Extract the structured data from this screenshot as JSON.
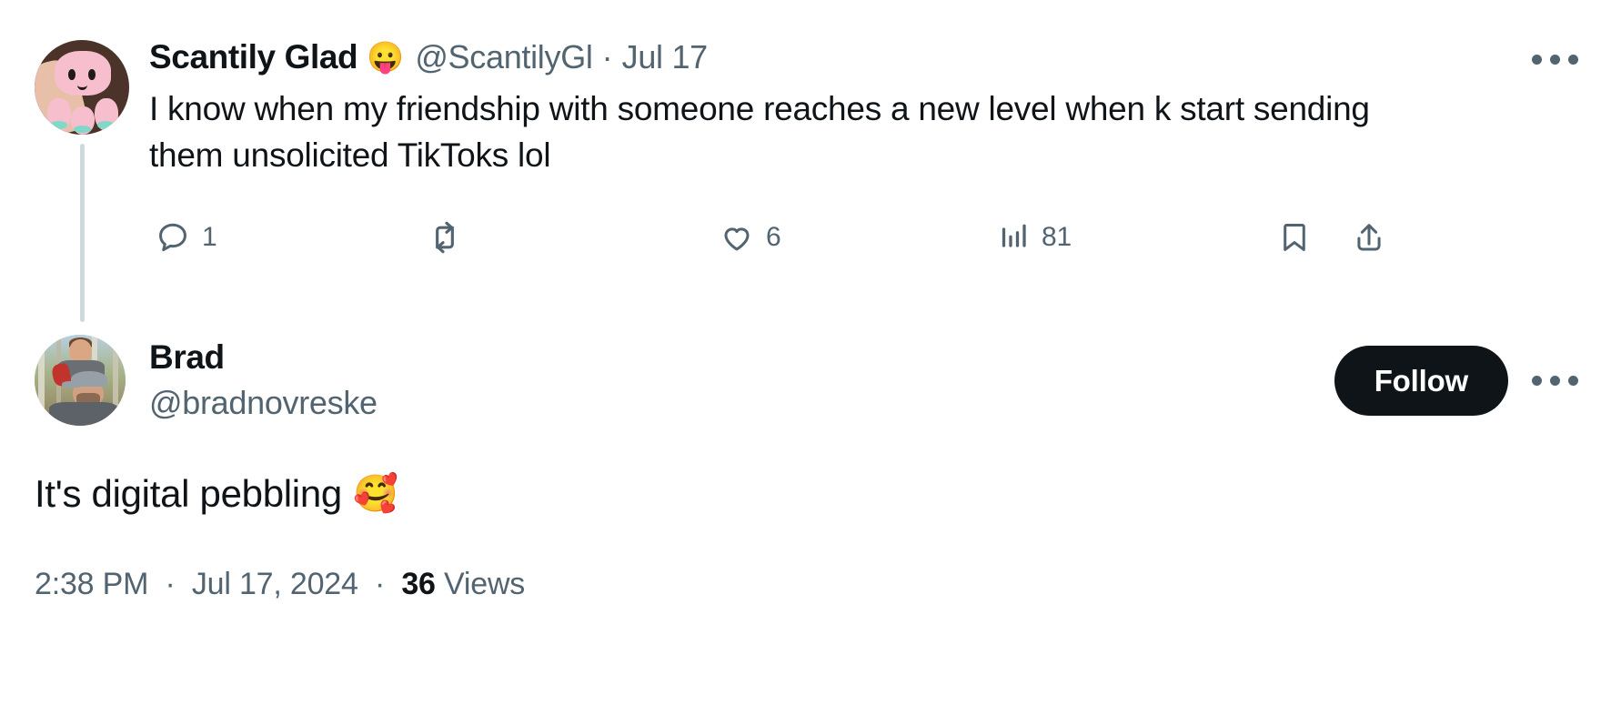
{
  "parent_tweet": {
    "avatar_name": "pink-octopus-plush-avatar",
    "display_name": "Scantily Glad",
    "name_emoji": "😛",
    "handle": "@ScantilyGl",
    "separator": "·",
    "date": "Jul 17",
    "text": "I know when my friendship with someone reaches a new level when k start sending them unsolicited TikToks lol",
    "actions": {
      "reply_count": "1",
      "retweet_count": "",
      "like_count": "6",
      "views_count": "81",
      "bookmark_label": "",
      "share_label": ""
    },
    "more_label": ""
  },
  "reply_tweet": {
    "avatar_name": "man-with-child-on-shoulders-avatar",
    "display_name": "Brad",
    "handle": "@bradnovreske",
    "follow_label": "Follow",
    "text": "It's digital pebbling",
    "text_emoji": "🥰",
    "meta": {
      "time": "2:38 PM",
      "sep1": "·",
      "date": "Jul 17, 2024",
      "sep2": "·",
      "views_count": "36",
      "views_label": "Views"
    },
    "more_label": ""
  },
  "colors": {
    "text_primary": "#0f1419",
    "text_secondary": "#536471",
    "thread_line": "#cfd9de",
    "follow_bg": "#0f1419",
    "follow_fg": "#ffffff",
    "background": "#ffffff"
  }
}
